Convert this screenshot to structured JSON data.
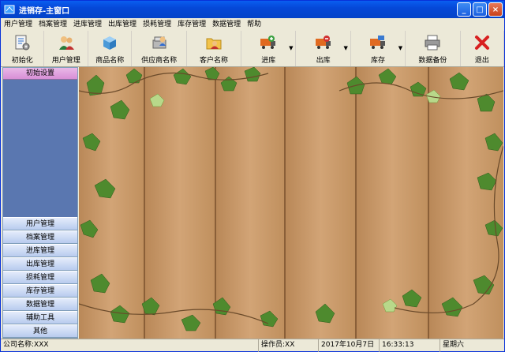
{
  "window": {
    "title": "进销存-主窗口",
    "buttons": {
      "minimize": "_",
      "maximize": "□",
      "close": "×"
    }
  },
  "menu": [
    "用户管理",
    "档案管理",
    "进库管理",
    "出库管理",
    "损耗管理",
    "库存管理",
    "数据管理",
    "帮助"
  ],
  "toolbar": [
    {
      "label": "初始化",
      "icon": "init-icon"
    },
    {
      "label": "用户管理",
      "icon": "users-icon"
    },
    {
      "label": "商品名称",
      "icon": "product-box-icon"
    },
    {
      "label": "供应商名称",
      "icon": "supplier-icon"
    },
    {
      "label": "客户名称",
      "icon": "customer-folder-icon"
    },
    {
      "label": "进库",
      "icon": "truck-in-icon",
      "dropdown": "▼"
    },
    {
      "label": "出库",
      "icon": "truck-out-icon",
      "dropdown": "▼"
    },
    {
      "label": "库存",
      "icon": "truck-stock-icon",
      "dropdown": "▼"
    },
    {
      "label": "数据备份",
      "icon": "printer-backup-icon"
    },
    {
      "label": "退出",
      "icon": "exit-x-icon"
    }
  ],
  "sidebar": {
    "header": "初始设置",
    "items": [
      "用户管理",
      "档案管理",
      "进库管理",
      "出库管理",
      "损耗管理",
      "库存管理",
      "数据管理",
      "辅助工具",
      "其他"
    ]
  },
  "status": {
    "company": "公司名称:XXX",
    "operator": "操作员:XX",
    "date": "2017年10月7日",
    "time": "16:33:13",
    "weekday": "星期六"
  },
  "colors": {
    "wood": "#c9996a",
    "leaf": "#4e8a2e",
    "titlebar": "#0548d8",
    "sidebar": "#5a77b0"
  }
}
